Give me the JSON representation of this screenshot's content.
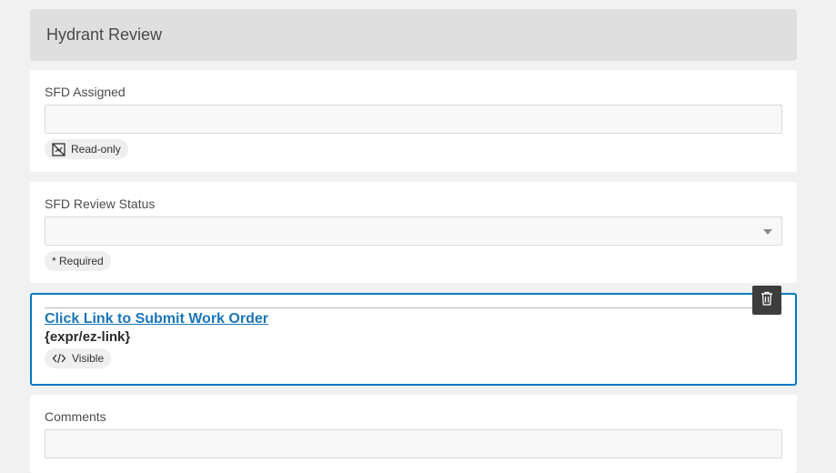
{
  "group": {
    "title": "Hydrant Review"
  },
  "fields": {
    "sfd_assigned": {
      "label": "SFD Assigned",
      "value": "",
      "badge": "Read-only"
    },
    "sfd_review_status": {
      "label": "SFD Review Status",
      "value": "",
      "badge": "* Required"
    },
    "work_order_text": {
      "link_text": "Click Link to Submit Work Order",
      "expression": "{expr/ez-link}",
      "badge": "Visible"
    },
    "comments": {
      "label": "Comments",
      "value": ""
    }
  },
  "icons": {
    "read_only": "read-only-icon",
    "visible": "code-icon",
    "delete": "trash-icon"
  },
  "colors": {
    "accent": "#007ac2",
    "link": "#1a76b8",
    "header_bg": "#dfdfdf",
    "delete_bg": "#3d3d3d"
  }
}
